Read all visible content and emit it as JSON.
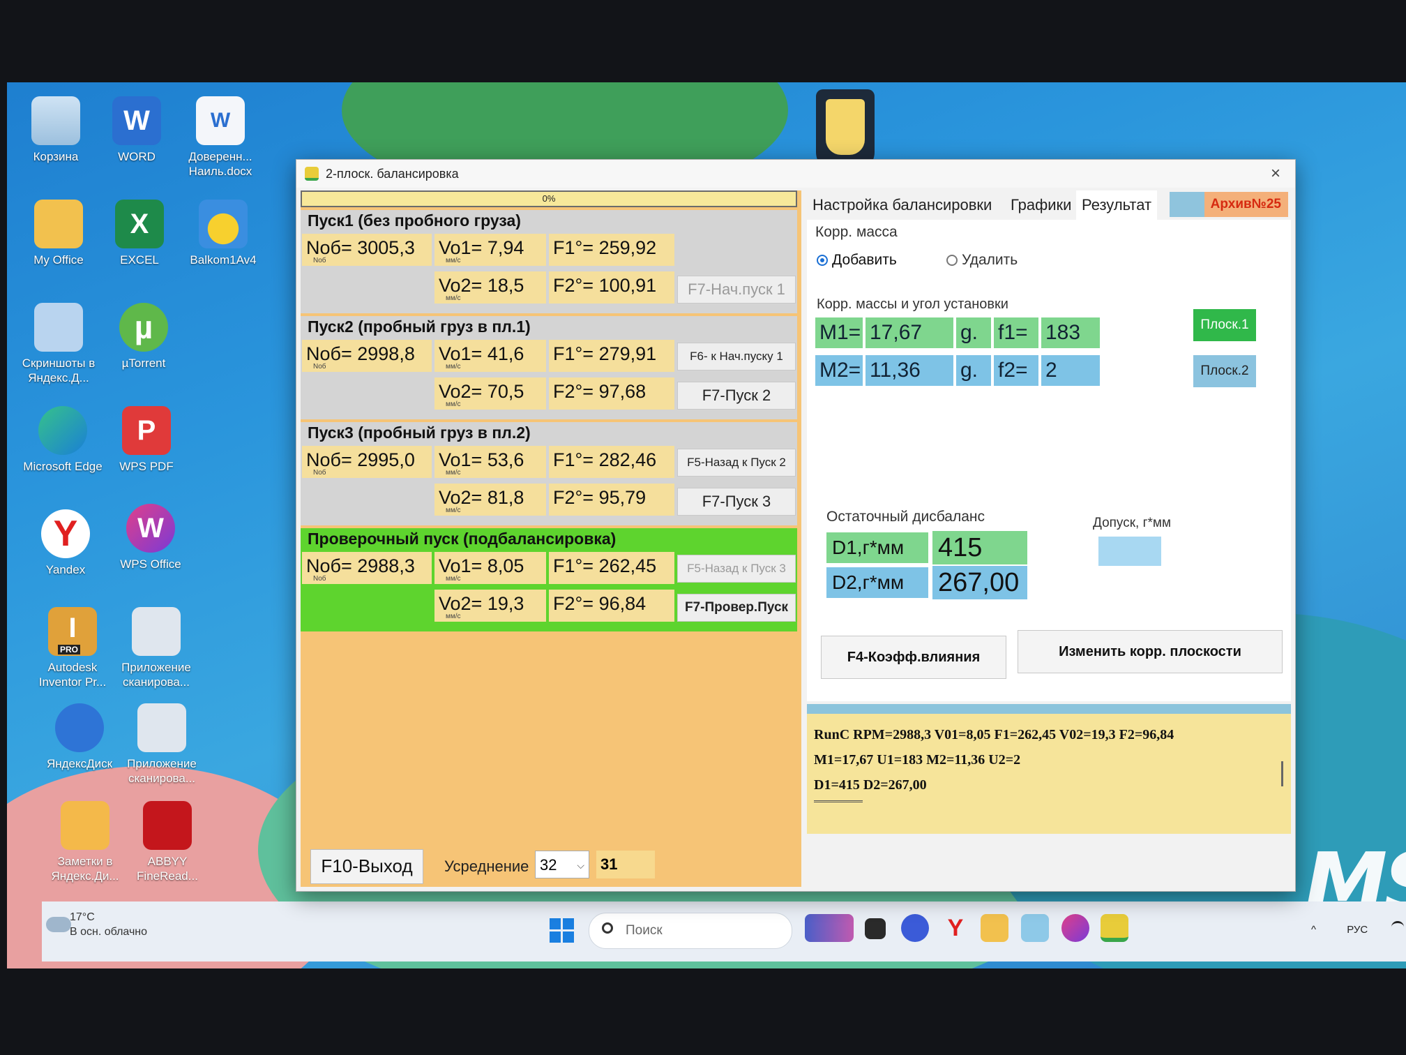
{
  "desktop": {
    "icons": [
      {
        "label": "Корзина"
      },
      {
        "label": "WORD"
      },
      {
        "label": "Доверенн... Наиль.docx"
      },
      {
        "label": "My Office"
      },
      {
        "label": "EXCEL"
      },
      {
        "label": "Balkom1Av4"
      },
      {
        "label": "Скриншоты в Яндекс.Д..."
      },
      {
        "label": "µTorrent"
      },
      {
        "label": "Microsoft Edge"
      },
      {
        "label": "WPS PDF"
      },
      {
        "label": "Yandex"
      },
      {
        "label": "WPS Office"
      },
      {
        "label": "Autodesk Inventor Pr..."
      },
      {
        "label": "Приложение сканирова..."
      },
      {
        "label": "ЯндексДиск"
      },
      {
        "label": "Приложение сканирова..."
      },
      {
        "label": "Заметки в Яндекс.Ди..."
      },
      {
        "label": "ABBYY FineRead..."
      }
    ],
    "brand_mark": "MSI",
    "icon_badges": {
      "word": "W",
      "excel": "X",
      "docx": "W",
      "torrent": "µ",
      "wps_pdf": "P",
      "yandex": "Y",
      "wps_office": "W",
      "inventor": "I",
      "inventor_pro": "PRO"
    }
  },
  "taskbar": {
    "weather_temp": "17°C",
    "weather_desc": "В осн. облачно",
    "search_placeholder": "Поиск",
    "lang": "РУС",
    "tray_chevron": "^",
    "yandex_glyph": "Y"
  },
  "window": {
    "title": "2-плоск. балансировка",
    "close": "×",
    "progress": "0%",
    "runs": [
      {
        "title": "Пуск1 (без пробного груза)",
        "nob": "Nоб= 3005,3",
        "vo1": "Vo1= 7,94",
        "f1": "F1°= 259,92",
        "vo2": "Vo2= 18,5",
        "f2": "F2°= 100,91",
        "btn_top": "",
        "btn_bottom": "F7-Нач.пуск 1"
      },
      {
        "title": "Пуск2 (пробный груз в пл.1)",
        "nob": "Nоб= 2998,8",
        "vo1": "Vo1= 41,6",
        "f1": "F1°= 279,91",
        "vo2": "Vo2= 70,5",
        "f2": "F2°= 97,68",
        "btn_top": "F6- к Нач.пуску 1",
        "btn_bottom": "F7-Пуск 2"
      },
      {
        "title": "Пуск3 (пробный груз в пл.2)",
        "nob": "Nоб= 2995,0",
        "vo1": "Vo1= 53,6",
        "f1": "F1°= 282,46",
        "vo2": "Vo2= 81,8",
        "f2": "F2°= 95,79",
        "btn_top": "F5-Назад к Пуск 2",
        "btn_bottom": "F7-Пуск 3"
      },
      {
        "title": "Проверочный пуск (подбалансировка)",
        "nob": "Nоб= 2988,3",
        "vo1": "Vo1= 8,05",
        "f1": "F1°= 262,45",
        "vo2": "Vo2= 19,3",
        "f2": "F2°= 96,84",
        "btn_top": "F5-Назад к Пуск 3",
        "btn_bottom": "F7-Провер.Пуск"
      }
    ],
    "units": {
      "nob": "Nоб",
      "v": "мм/с"
    },
    "exit": "F10-Выход",
    "averaging_label": "Усреднение",
    "averaging_value": "32",
    "averaging_count": "31",
    "tabs": [
      "Настройка балансировки",
      "Графики",
      "Результат"
    ],
    "archive_tab": "Архив№25",
    "corr_mass_label": "Корр. масса",
    "add_label": "Добавить",
    "remove_label": "Удалить",
    "mass_angle_label": "Корр. массы и угол установки",
    "m1_label": "M1=",
    "m1_value": "17,67",
    "g_unit": "g.",
    "f1_label": "f1=",
    "f1_value": "183",
    "m2_label": "M2=",
    "m2_value": "11,36",
    "f2_label": "f2=",
    "f2_value": "2",
    "plane1_btn": "Плоск.1",
    "plane2_btn": "Плоск.2",
    "residual_label": "Остаточный дисбаланс",
    "tolerance_label": "Допуск, г*мм",
    "d1_label": "D1,г*мм",
    "d1_value": "415",
    "d2_label": "D2,г*мм",
    "d2_value": "267,00",
    "coef_btn": "F4-Коэфф.влияния",
    "change_planes_btn": "Изменить корр. плоскости",
    "log_lines": [
      "RunC  RPM=2988,3 V01=8,05 F1=262,45 V02=19,3 F2=96,84",
      "M1=17,67 U1=183 M2=11,36 U2=2",
      "D1=415 D2=267,00"
    ]
  }
}
